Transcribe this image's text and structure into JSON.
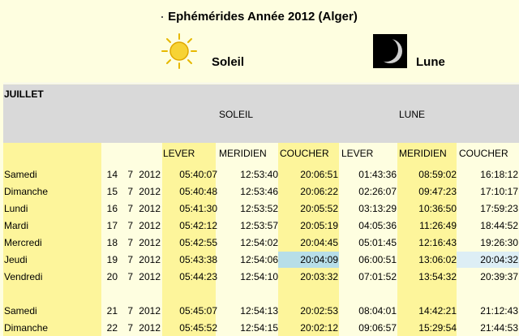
{
  "title": "Ephémérides Année 2012 (Alger)",
  "icons": {
    "sun": "sun-icon",
    "moon": "moon-icon"
  },
  "labels": {
    "soleil": "Soleil",
    "lune": "Lune"
  },
  "table": {
    "month": "JUILLET",
    "group_soleil": "SOLEIL",
    "group_lune": "LUNE",
    "col_lever": "LEVER",
    "col_meridien": "MERIDIEN",
    "col_coucher": "COUCHER",
    "col_lever2": "LEVER",
    "col_meridien2": "MERIDIEN",
    "col_coucher2": "COUCHER",
    "rows": [
      {
        "day": "Samedi",
        "d": "14",
        "m": "7",
        "y": "2012",
        "sl": "05:40:07",
        "sm": "12:53:40",
        "sc": "20:06:51",
        "ll": "01:43:36",
        "lm": "08:59:02",
        "lc": "16:18:12"
      },
      {
        "day": "Dimanche",
        "d": "15",
        "m": "7",
        "y": "2012",
        "sl": "05:40:48",
        "sm": "12:53:46",
        "sc": "20:06:22",
        "ll": "02:26:07",
        "lm": "09:47:23",
        "lc": "17:10:17"
      },
      {
        "day": "Lundi",
        "d": "16",
        "m": "7",
        "y": "2012",
        "sl": "05:41:30",
        "sm": "12:53:52",
        "sc": "20:05:52",
        "ll": "03:13:29",
        "lm": "10:36:50",
        "lc": "17:59:23"
      },
      {
        "day": "Mardi",
        "d": "17",
        "m": "7",
        "y": "2012",
        "sl": "05:42:12",
        "sm": "12:53:57",
        "sc": "20:05:19",
        "ll": "04:05:36",
        "lm": "11:26:49",
        "lc": "18:44:52"
      },
      {
        "day": "Mercredi",
        "d": "18",
        "m": "7",
        "y": "2012",
        "sl": "05:42:55",
        "sm": "12:54:02",
        "sc": "20:04:45",
        "ll": "05:01:45",
        "lm": "12:16:43",
        "lc": "19:26:30"
      },
      {
        "day": "Jeudi",
        "d": "19",
        "m": "7",
        "y": "2012",
        "sl": "05:43:38",
        "sm": "12:54:06",
        "sc": "20:04:09",
        "ll": "06:00:51",
        "lm": "13:06:02",
        "lc": "20:04:32"
      },
      {
        "day": "Vendredi",
        "d": "20",
        "m": "7",
        "y": "2012",
        "sl": "05:44:23",
        "sm": "12:54:10",
        "sc": "20:03:32",
        "ll": "07:01:52",
        "lm": "13:54:32",
        "lc": "20:39:37"
      },
      {
        "day": "Samedi",
        "d": "21",
        "m": "7",
        "y": "2012",
        "sl": "05:45:07",
        "sm": "12:54:13",
        "sc": "20:02:53",
        "ll": "08:04:01",
        "lm": "14:42:21",
        "lc": "21:12:43"
      },
      {
        "day": "Dimanche",
        "d": "22",
        "m": "7",
        "y": "2012",
        "sl": "05:45:52",
        "sm": "12:54:15",
        "sc": "20:02:12",
        "ll": "09:06:57",
        "lm": "15:29:54",
        "lc": "21:44:53"
      }
    ]
  }
}
